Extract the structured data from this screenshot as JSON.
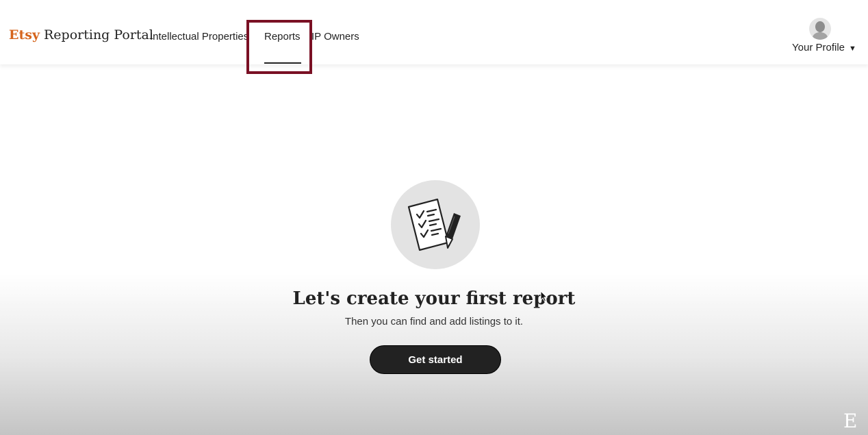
{
  "header": {
    "brand_name": "Etsy",
    "portal_name": "Reporting Portal",
    "nav": {
      "intellectual_properties": "Intellectual Properties",
      "reports": "Reports",
      "ip_owners": "IP Owners"
    },
    "active_tab": "Reports",
    "profile_label": "Your Profile",
    "profile_caret": "▼"
  },
  "main": {
    "icon": "checklist-pencil-icon",
    "heading": "Let's create your first report",
    "subtext": "Then you can find and add listings to it.",
    "cta_label": "Get started"
  },
  "watermark": "E",
  "colors": {
    "brand_orange": "#d5641c",
    "highlight_box": "#7a1024",
    "button_bg": "#222222",
    "illustration_bg": "#e3e3e3"
  }
}
